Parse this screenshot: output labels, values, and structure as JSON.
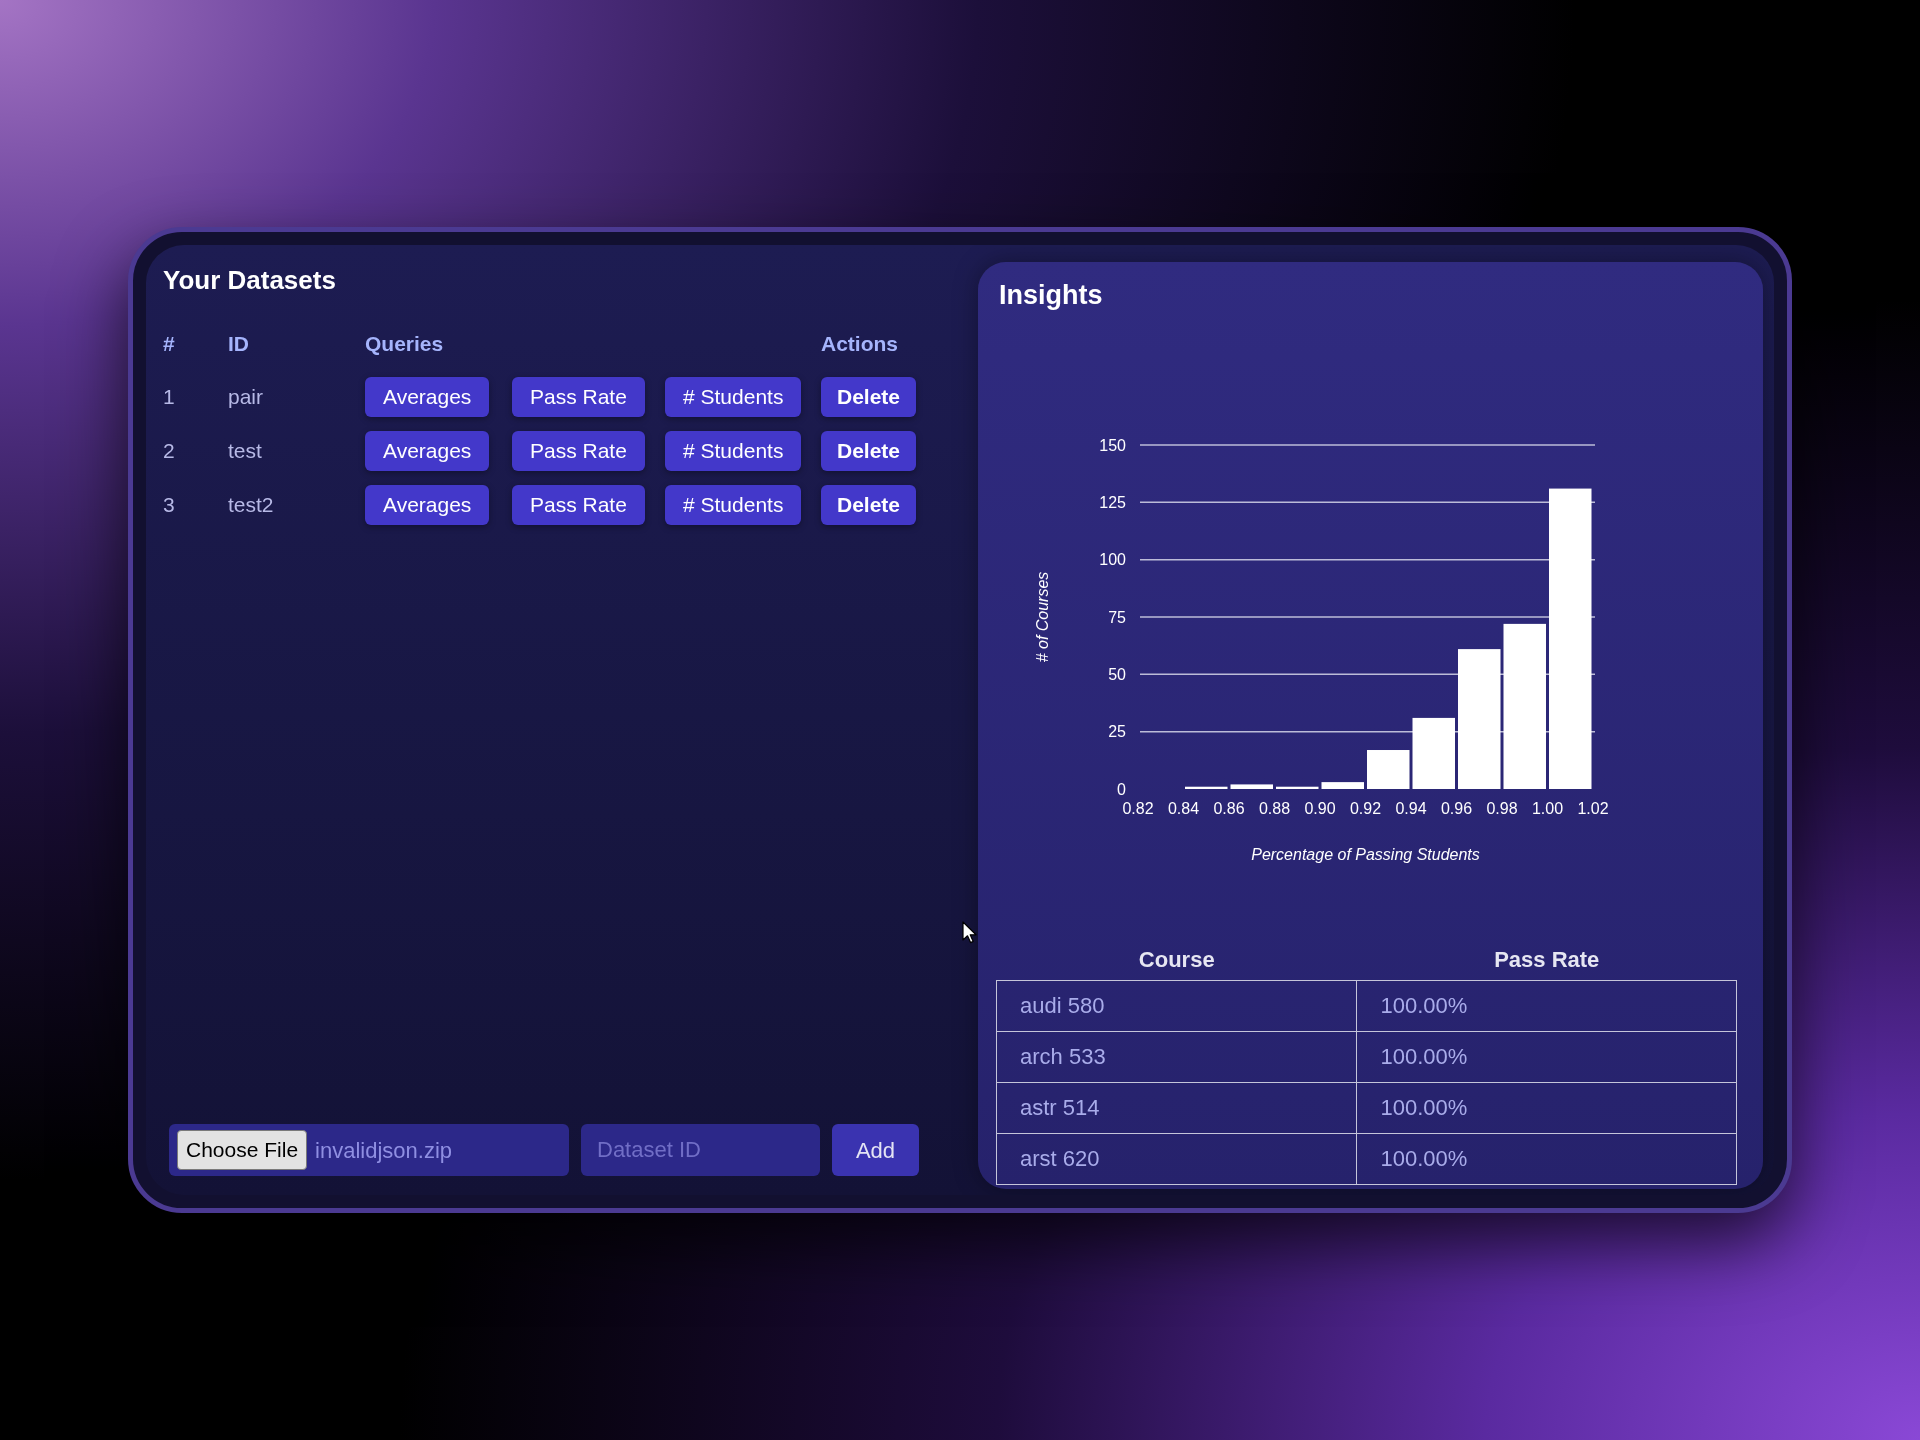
{
  "datasets_panel": {
    "title": "Your Datasets",
    "columns": [
      "#",
      "ID",
      "Queries",
      "Actions"
    ],
    "rows": [
      {
        "number": "1",
        "id": "pair",
        "queries": [
          "Averages",
          "Pass Rate",
          "# Students"
        ],
        "action": "Delete"
      },
      {
        "number": "2",
        "id": "test",
        "queries": [
          "Averages",
          "Pass Rate",
          "# Students"
        ],
        "action": "Delete"
      },
      {
        "number": "3",
        "id": "test2",
        "queries": [
          "Averages",
          "Pass Rate",
          "# Students"
        ],
        "action": "Delete"
      }
    ],
    "upload_form": {
      "file_button": "Choose File",
      "file_name": "invalidjson.zip",
      "dataset_id_field": {
        "placeholder": "Dataset ID"
      },
      "submit_button": "Add"
    }
  },
  "insights_panel": {
    "title": "Insights",
    "chart_data": {
      "type": "bar",
      "xlabel": "Percentage of Passing Students",
      "ylabel": "# of Courses",
      "x": [
        0.83,
        0.85,
        0.87,
        0.89,
        0.91,
        0.93,
        0.95,
        0.97,
        0.99,
        1.01
      ],
      "values": [
        0,
        1,
        2,
        1,
        3,
        17,
        31,
        61,
        72,
        131
      ],
      "xlim": [
        0.82,
        1.02
      ],
      "ylim": [
        0,
        150
      ],
      "grid": true,
      "xticks": [
        {
          "value": 0.82,
          "label": "0.82"
        },
        {
          "value": 0.84,
          "label": "0.84"
        },
        {
          "value": 0.86,
          "label": "0.86"
        },
        {
          "value": 0.88,
          "label": "0.88"
        },
        {
          "value": 0.9,
          "label": "0.90"
        },
        {
          "value": 0.92,
          "label": "0.92"
        },
        {
          "value": 0.94,
          "label": "0.94"
        },
        {
          "value": 0.96,
          "label": "0.96"
        },
        {
          "value": 0.98,
          "label": "0.98"
        },
        {
          "value": 1.0,
          "label": "1.00"
        },
        {
          "value": 1.02,
          "label": "1.02"
        }
      ],
      "yticks": [
        0,
        25,
        50,
        75,
        100,
        125,
        150
      ]
    },
    "table": {
      "columns": [
        "Course",
        "Pass Rate"
      ],
      "rows": [
        {
          "course": "audi 580",
          "pass_rate": "100.00%"
        },
        {
          "course": "arch 533",
          "pass_rate": "100.00%"
        },
        {
          "course": "astr 514",
          "pass_rate": "100.00%"
        },
        {
          "course": "arst 620",
          "pass_rate": "100.00%"
        }
      ]
    }
  }
}
